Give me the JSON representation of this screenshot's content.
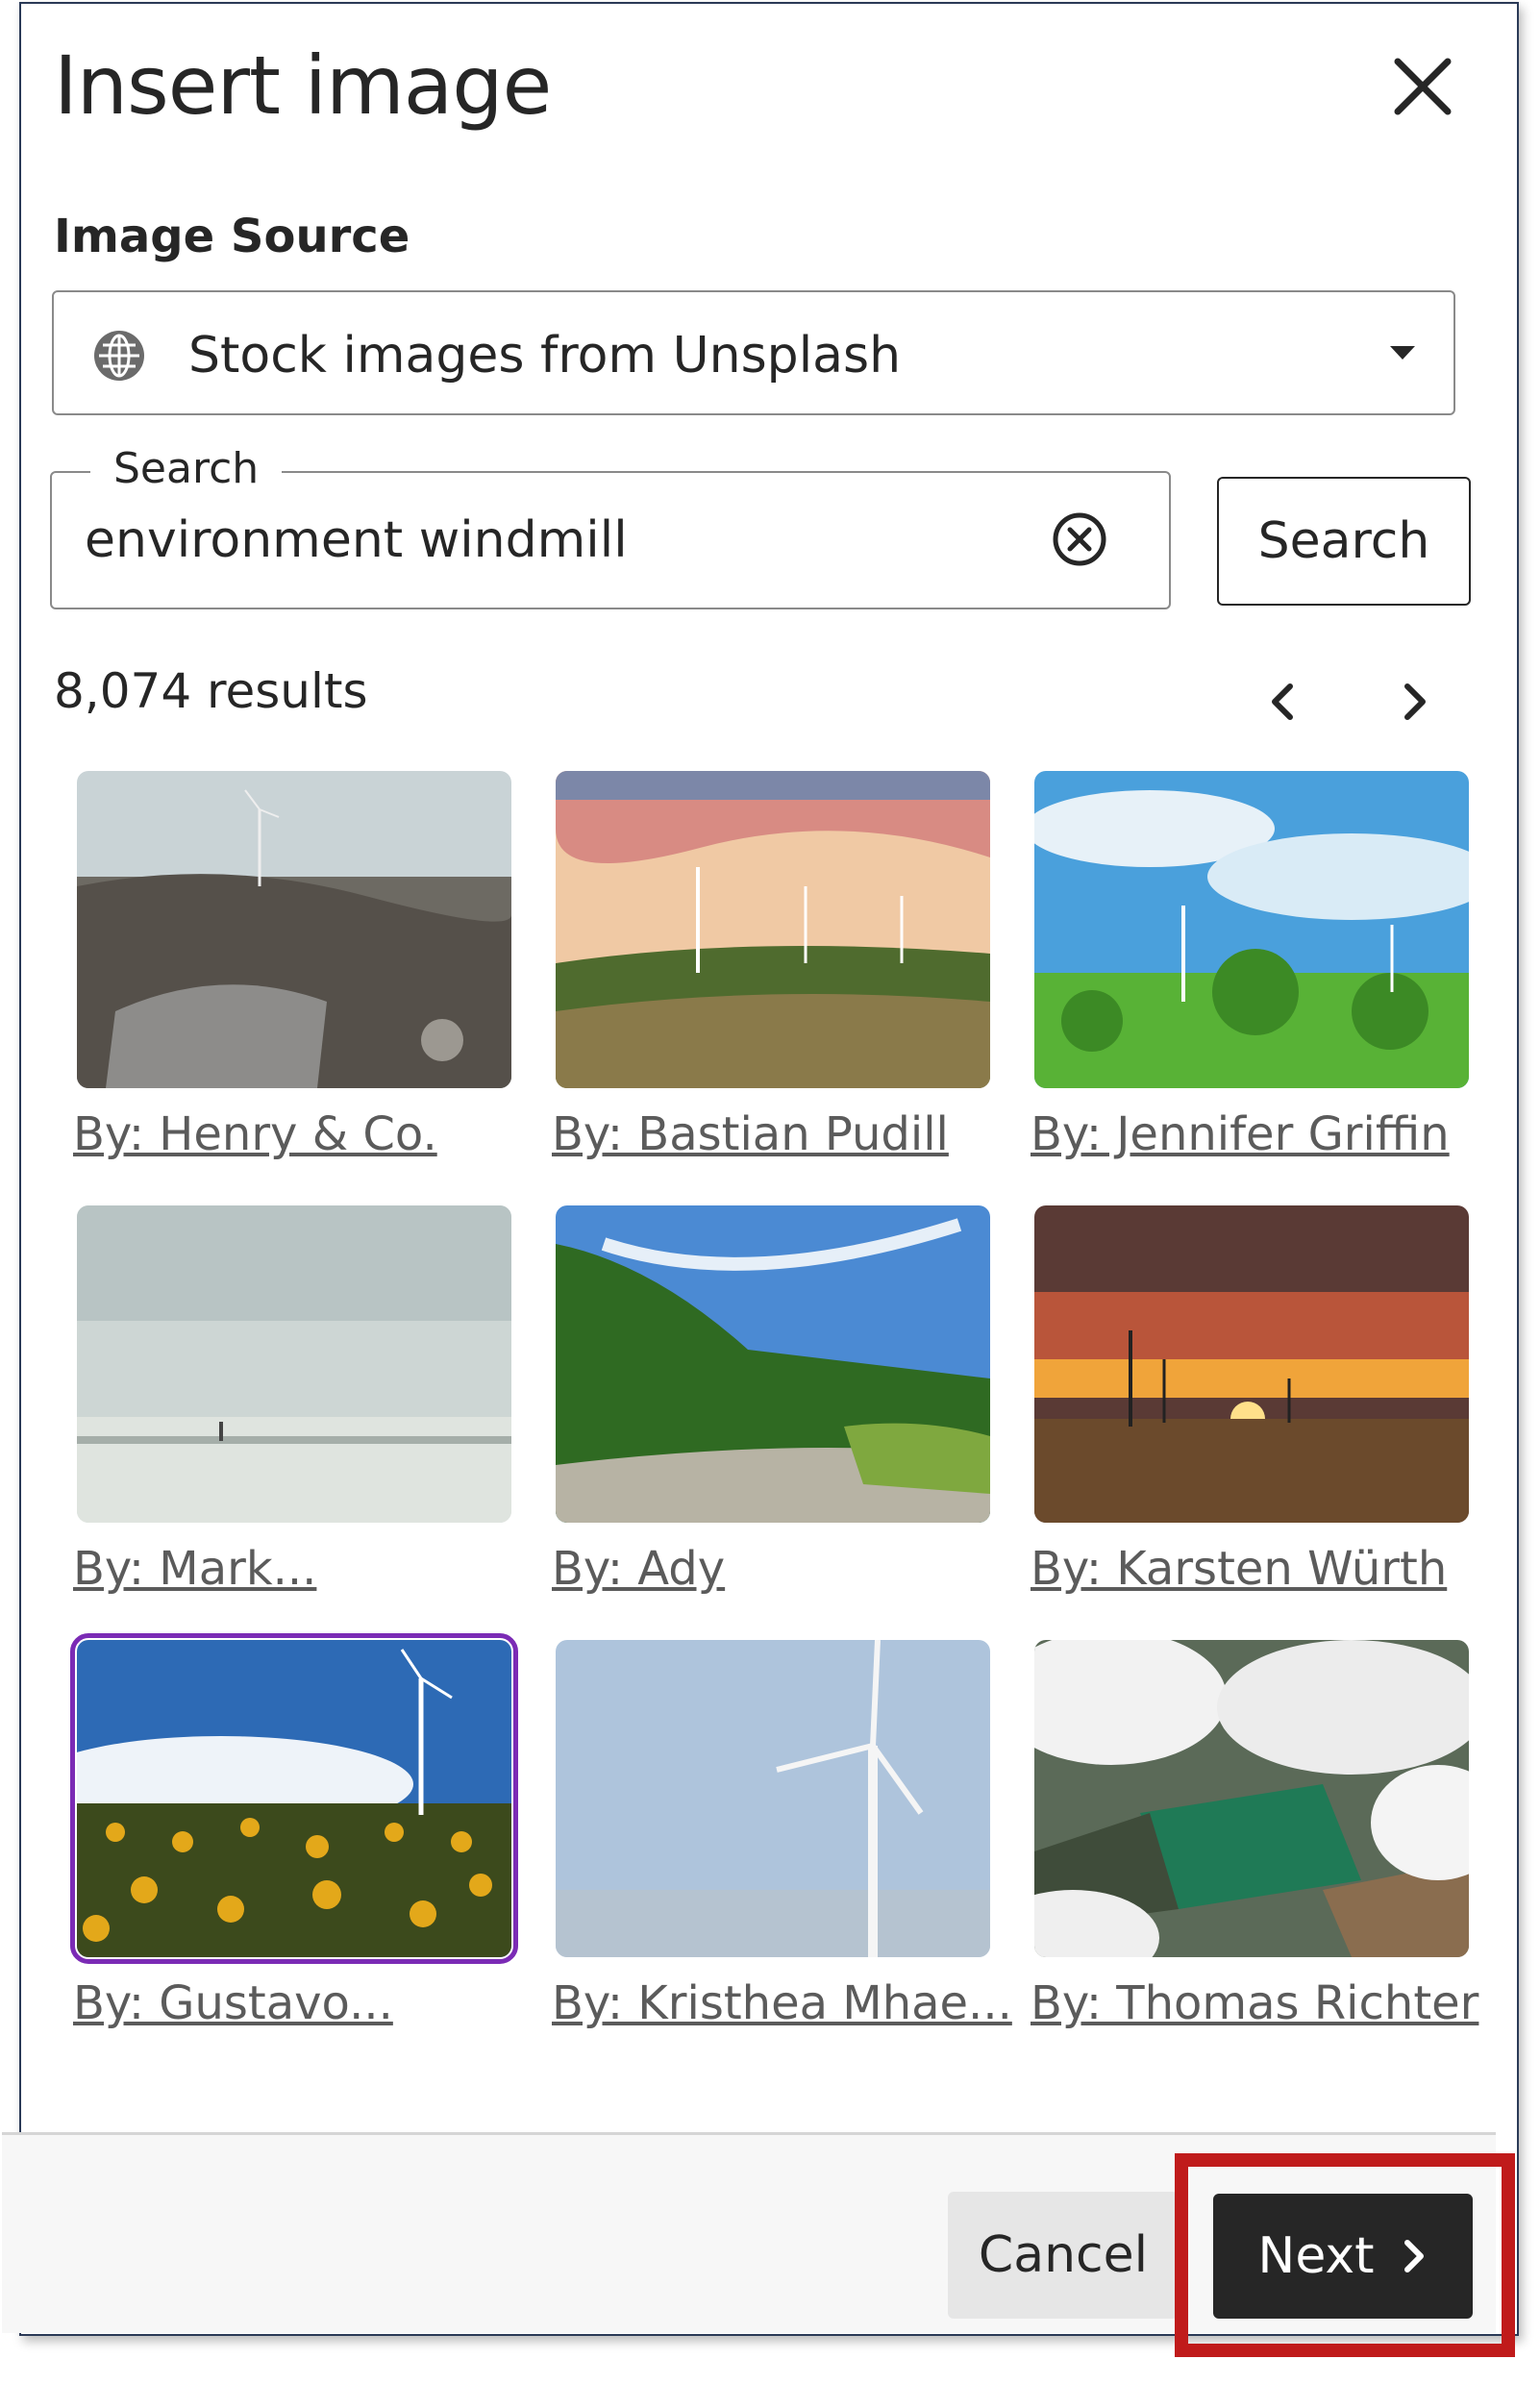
{
  "dialog": {
    "title": "Insert image",
    "close_icon": "close-icon"
  },
  "image_source": {
    "label": "Image Source",
    "selected": "Stock images from Unsplash",
    "icon": "globe-icon"
  },
  "search": {
    "legend": "Search",
    "value": "environment windmill",
    "button_label": "Search",
    "clear_icon": "clear-circle-icon"
  },
  "results": {
    "count_text": "8,074 results",
    "prev_icon": "chevron-left-icon",
    "next_icon": "chevron-right-icon"
  },
  "images": [
    {
      "caption": "By: Henry & Co.",
      "scene": "rocky-shore-windmill"
    },
    {
      "caption": "By: Bastian Pudill",
      "scene": "sunset-field-turbines"
    },
    {
      "caption": "By: Jennifer Griffin",
      "scene": "green-field-turbines"
    },
    {
      "caption": "By: Mark...",
      "scene": "misty-beach"
    },
    {
      "caption": "By: Ady",
      "scene": "forest-road"
    },
    {
      "caption": "By: Karsten Würth",
      "scene": "sunset-wheat-turbines"
    },
    {
      "caption": "By: Gustavo...",
      "scene": "sunflower-field-turbine",
      "selected": true
    },
    {
      "caption": "By: Kristhea Mhae...",
      "scene": "sky-turbine"
    },
    {
      "caption": "By: Thomas Richter",
      "scene": "aerial-clouds"
    }
  ],
  "footer": {
    "cancel_label": "Cancel",
    "next_label": "Next",
    "next_icon": "chevron-right-icon"
  },
  "colors": {
    "selected_outline": "#7b2bb5",
    "primary_button": "#262626",
    "annotation_highlight": "#c01b1b"
  }
}
